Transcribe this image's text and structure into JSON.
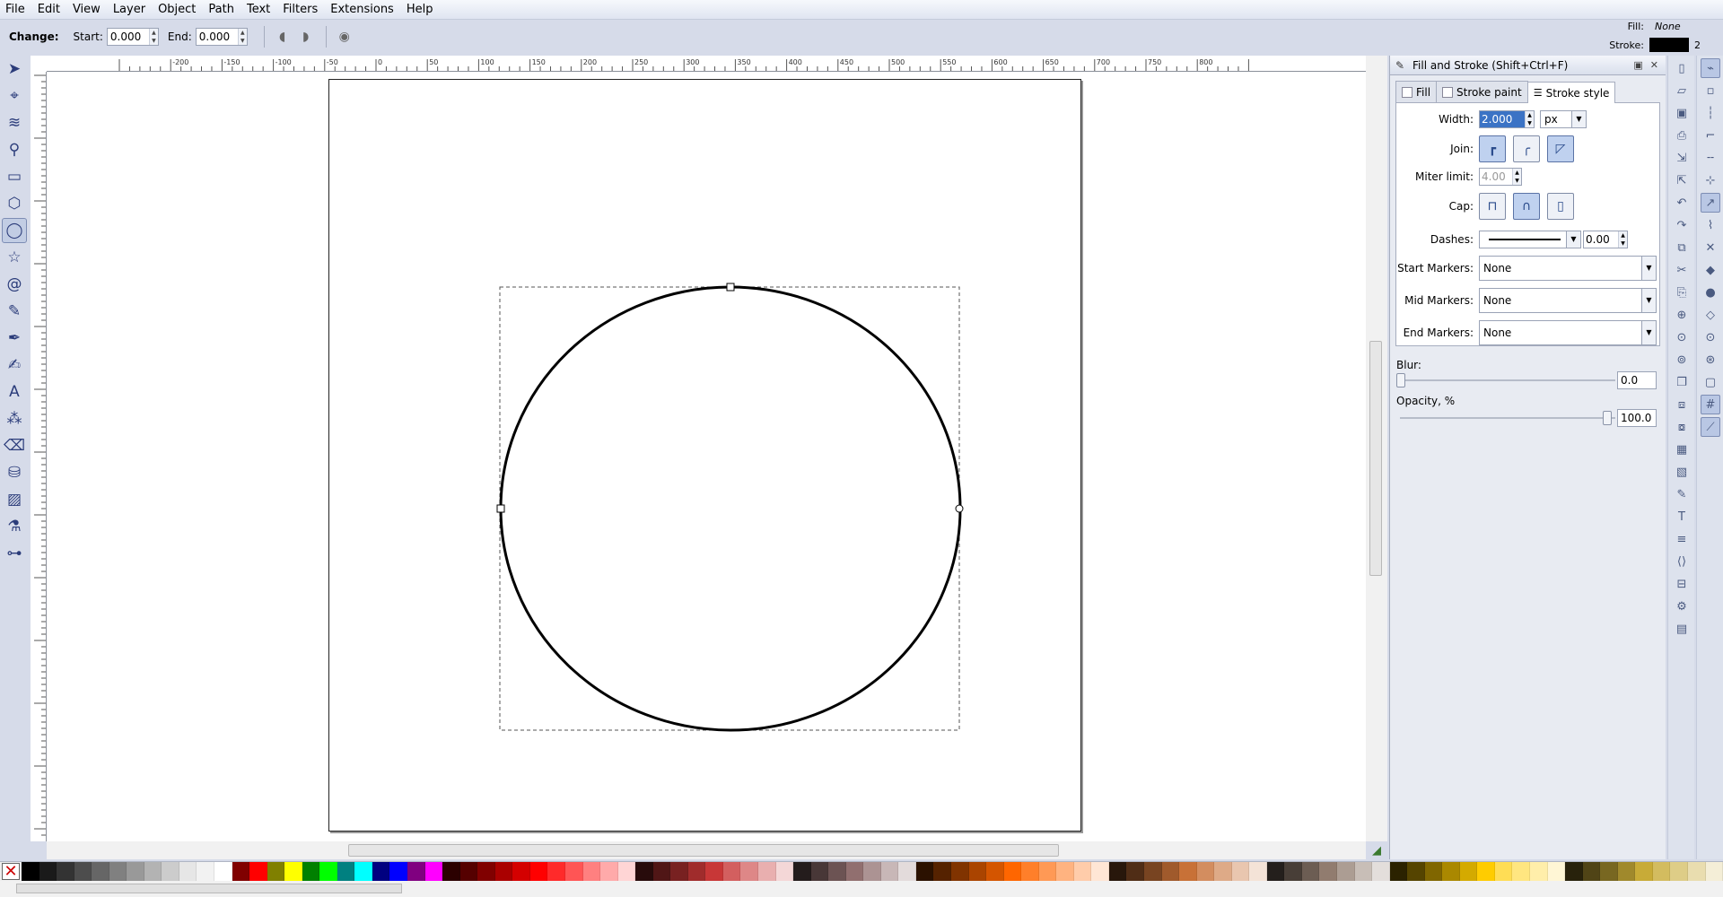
{
  "menu": [
    "File",
    "Edit",
    "View",
    "Layer",
    "Object",
    "Path",
    "Text",
    "Filters",
    "Extensions",
    "Help"
  ],
  "indicator": {
    "fill_label": "Fill:",
    "fill_value": "None",
    "stroke_label": "Stroke:",
    "stroke_width": "2",
    "stroke_color": "#000000"
  },
  "controls": {
    "change_label": "Change:",
    "start_label": "Start:",
    "start_value": "0.000",
    "end_label": "End:",
    "end_value": "0.000"
  },
  "tools": [
    "selector-icon",
    "node-icon",
    "tweak-icon",
    "zoom-icon",
    "rect-icon",
    "box3d-icon",
    "ellipse-icon",
    "star-icon",
    "spiral-icon",
    "pencil-icon",
    "pen-icon",
    "calligraphy-icon",
    "text-icon",
    "spray-icon",
    "eraser-icon",
    "bucket-icon",
    "gradient-icon",
    "dropper-icon",
    "connector-icon"
  ],
  "ruler_labels": [
    "-200",
    "-150",
    "-100",
    "-50",
    "0",
    "50",
    "100",
    "150",
    "200",
    "250",
    "300",
    "350",
    "400",
    "450",
    "500",
    "550",
    "600",
    "650",
    "700",
    "750",
    "800"
  ],
  "dialog": {
    "title": "Fill and Stroke (Shift+Ctrl+F)",
    "tabs": [
      "Fill",
      "Stroke paint",
      "Stroke style"
    ],
    "width_label": "Width:",
    "width_value": "2.000",
    "width_unit": "px",
    "join_label": "Join:",
    "miter_label": "Miter limit:",
    "miter_value": "4.00",
    "cap_label": "Cap:",
    "dashes_label": "Dashes:",
    "dashes_value": "0.00",
    "start_markers_label": "Start Markers:",
    "start_markers_value": "None",
    "mid_markers_label": "Mid Markers:",
    "mid_markers_value": "None",
    "end_markers_label": "End Markers:",
    "end_markers_value": "None",
    "blur_label": "Blur:",
    "blur_value": "0.0",
    "opacity_label": "Opacity, %",
    "opacity_value": "100.0"
  },
  "palette": [
    "#000000",
    "#1a1a1a",
    "#333333",
    "#4d4d4d",
    "#666666",
    "#808080",
    "#999999",
    "#b3b3b3",
    "#cccccc",
    "#e6e6e6",
    "#f2f2f2",
    "#ffffff",
    "#800000",
    "#ff0000",
    "#808000",
    "#ffff00",
    "#008000",
    "#00ff00",
    "#008080",
    "#00ffff",
    "#000080",
    "#0000ff",
    "#800080",
    "#ff00ff",
    "#2b0000",
    "#550000",
    "#800000",
    "#aa0000",
    "#d40000",
    "#ff0000",
    "#ff2a2a",
    "#ff5555",
    "#ff8080",
    "#ffaaaa",
    "#ffd5d5",
    "#280b0b",
    "#501616",
    "#782121",
    "#a02c2c",
    "#c83737",
    "#d35f5f",
    "#de8787",
    "#e9afaf",
    "#f4d7d7",
    "#241c1c",
    "#483737",
    "#6c5353",
    "#916f6f",
    "#ac9393",
    "#c8b7b7",
    "#e3dbdb",
    "#2b1100",
    "#552200",
    "#803300",
    "#aa4400",
    "#d45500",
    "#ff6600",
    "#ff7f2a",
    "#ff9955",
    "#ffb380",
    "#ffccaa",
    "#ffe6d5",
    "#28170b",
    "#502d16",
    "#784421",
    "#a05a2c",
    "#c87137",
    "#d38d5f",
    "#deaa87",
    "#e9c6af",
    "#f4e3d7",
    "#241f1c",
    "#483e37",
    "#6c5d53",
    "#917c6f",
    "#ac9d93",
    "#c8beb7",
    "#e3dedb",
    "#2b2200",
    "#554400",
    "#806600",
    "#aa8800",
    "#d4aa00",
    "#ffcc00",
    "#ffdd55",
    "#ffe680",
    "#ffeeaa",
    "#fff6d5",
    "#28220b",
    "#504416",
    "#786721",
    "#a0892c",
    "#c8ab37",
    "#d3bc5f",
    "#decd87",
    "#e9ddaf",
    "#f4eed7"
  ]
}
